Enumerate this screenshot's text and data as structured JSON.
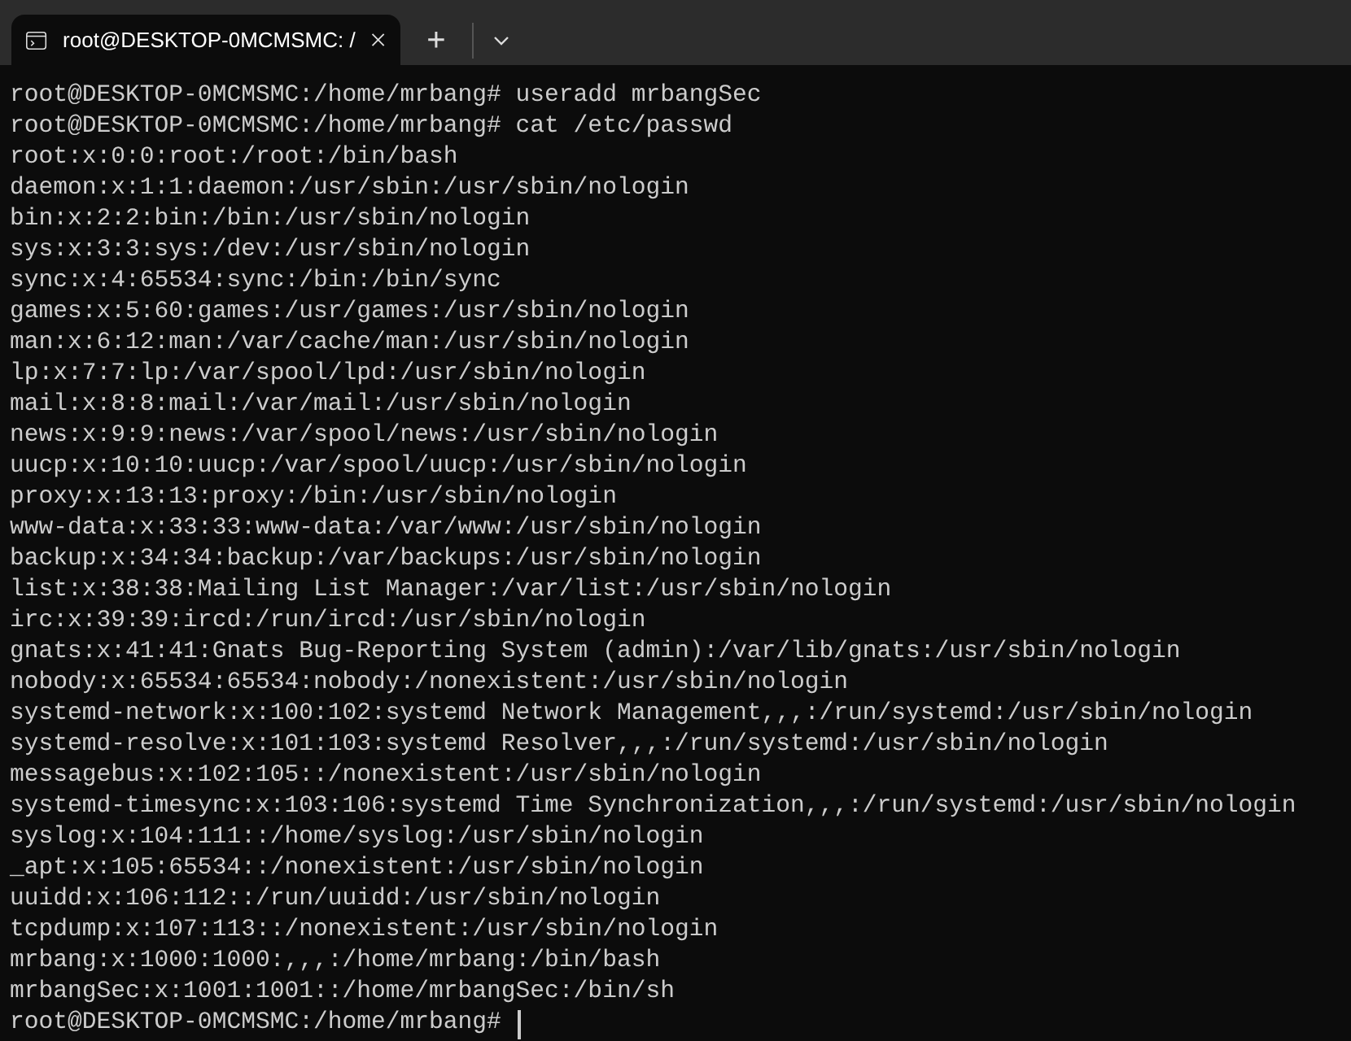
{
  "tab": {
    "title": "root@DESKTOP-0MCMSMC: /",
    "selected": true
  },
  "new_tab_button": "+",
  "lines": [
    "root@DESKTOP-0MCMSMC:/home/mrbang# useradd mrbangSec",
    "root@DESKTOP-0MCMSMC:/home/mrbang# cat /etc/passwd",
    "root:x:0:0:root:/root:/bin/bash",
    "daemon:x:1:1:daemon:/usr/sbin:/usr/sbin/nologin",
    "bin:x:2:2:bin:/bin:/usr/sbin/nologin",
    "sys:x:3:3:sys:/dev:/usr/sbin/nologin",
    "sync:x:4:65534:sync:/bin:/bin/sync",
    "games:x:5:60:games:/usr/games:/usr/sbin/nologin",
    "man:x:6:12:man:/var/cache/man:/usr/sbin/nologin",
    "lp:x:7:7:lp:/var/spool/lpd:/usr/sbin/nologin",
    "mail:x:8:8:mail:/var/mail:/usr/sbin/nologin",
    "news:x:9:9:news:/var/spool/news:/usr/sbin/nologin",
    "uucp:x:10:10:uucp:/var/spool/uucp:/usr/sbin/nologin",
    "proxy:x:13:13:proxy:/bin:/usr/sbin/nologin",
    "www-data:x:33:33:www-data:/var/www:/usr/sbin/nologin",
    "backup:x:34:34:backup:/var/backups:/usr/sbin/nologin",
    "list:x:38:38:Mailing List Manager:/var/list:/usr/sbin/nologin",
    "irc:x:39:39:ircd:/run/ircd:/usr/sbin/nologin",
    "gnats:x:41:41:Gnats Bug-Reporting System (admin):/var/lib/gnats:/usr/sbin/nologin",
    "nobody:x:65534:65534:nobody:/nonexistent:/usr/sbin/nologin",
    "systemd-network:x:100:102:systemd Network Management,,,:/run/systemd:/usr/sbin/nologin",
    "systemd-resolve:x:101:103:systemd Resolver,,,:/run/systemd:/usr/sbin/nologin",
    "messagebus:x:102:105::/nonexistent:/usr/sbin/nologin",
    "systemd-timesync:x:103:106:systemd Time Synchronization,,,:/run/systemd:/usr/sbin/nologin",
    "syslog:x:104:111::/home/syslog:/usr/sbin/nologin",
    "_apt:x:105:65534::/nonexistent:/usr/sbin/nologin",
    "uuidd:x:106:112::/run/uuidd:/usr/sbin/nologin",
    "tcpdump:x:107:113::/nonexistent:/usr/sbin/nologin",
    "mrbang:x:1000:1000:,,,:/home/mrbang:/bin/bash",
    "mrbangSec:x:1001:1001::/home/mrbangSec:/bin/sh"
  ],
  "prompt": "root@DESKTOP-0MCMSMC:/home/mrbang#"
}
